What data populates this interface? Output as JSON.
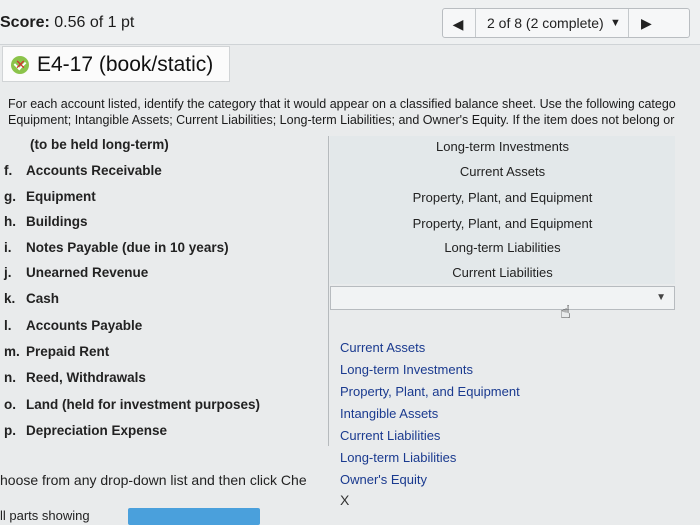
{
  "header": {
    "score_label": "Score:",
    "score_value": "0.56 of 1 pt",
    "pager_label": "2 of 8 (2 complete)"
  },
  "question": {
    "title": "E4-17 (book/static)",
    "instruction_line1": "For each account listed, identify the category that it would appear on a classified balance sheet. Use the following catego",
    "instruction_line2": "Equipment; Intangible Assets; Current Liabilities; Long-term Liabilities; and Owner's Equity. If the item does not belong or"
  },
  "items": [
    {
      "letter": "",
      "label": "(to be held long-term)",
      "answer": "Long-term Investments"
    },
    {
      "letter": "f.",
      "label": "Accounts Receivable",
      "answer": "Current Assets"
    },
    {
      "letter": "g.",
      "label": "Equipment",
      "answer": "Property, Plant, and Equipment"
    },
    {
      "letter": "h.",
      "label": "Buildings",
      "answer": "Property, Plant, and Equipment"
    },
    {
      "letter": "i.",
      "label": "Notes Payable (due in 10 years)",
      "answer": "Long-term Liabilities"
    },
    {
      "letter": "j.",
      "label": "Unearned Revenue",
      "answer": "Current Liabilities"
    },
    {
      "letter": "k.",
      "label": "Cash",
      "answer": ""
    },
    {
      "letter": "l.",
      "label": "Accounts Payable",
      "answer": ""
    },
    {
      "letter": "m.",
      "label": "Prepaid Rent",
      "answer": ""
    },
    {
      "letter": "n.",
      "label": "Reed, Withdrawals",
      "answer": ""
    },
    {
      "letter": "o.",
      "label": "Land (held for investment purposes)",
      "answer": ""
    },
    {
      "letter": "p.",
      "label": "Depreciation Expense",
      "answer": ""
    }
  ],
  "dropdown": {
    "options": [
      "Current Assets",
      "Long-term Investments",
      "Property, Plant, and Equipment",
      "Intangible Assets",
      "Current Liabilities",
      "Long-term Liabilities",
      "Owner's Equity"
    ],
    "close_label": "X"
  },
  "footer": {
    "choose_text": "hoose from any drop-down list and then click Che",
    "parts_text": "ll parts showing"
  },
  "icons": {
    "prev": "triangle-left-icon",
    "next": "triangle-right-icon",
    "pager_menu": "caret-down-icon",
    "status": "partial-credit-icon",
    "cursor": "hand-pointer-icon",
    "select_arrow": "caret-down-icon"
  },
  "colors": {
    "option_text": "#1a3a8f",
    "progress_bar": "#4aa0dc",
    "status_icon": "#8bc34a"
  }
}
